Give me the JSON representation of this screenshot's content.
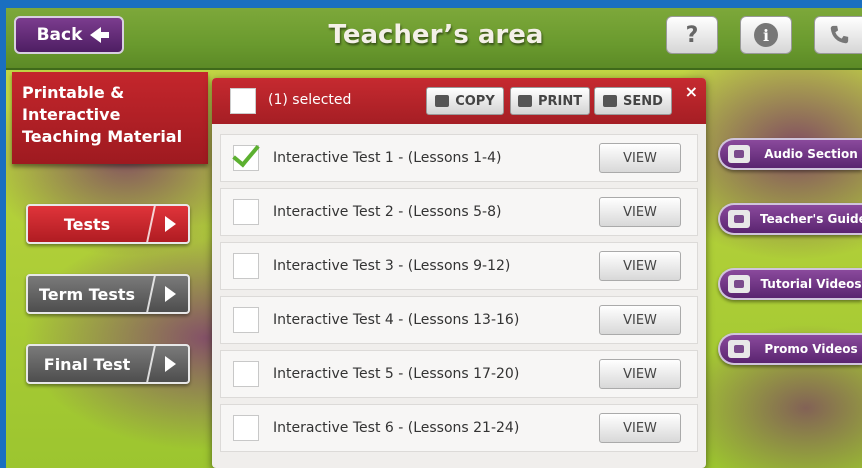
{
  "header": {
    "back_label": "Back",
    "title": "Teacher’s area",
    "help_glyph": "?",
    "info_glyph": "i",
    "icons": [
      "help-icon",
      "info-icon",
      "phone-icon"
    ]
  },
  "left": {
    "header_lines": [
      "Printable &",
      "Interactive",
      "Teaching Material"
    ],
    "buttons": [
      {
        "label": "Tests",
        "active": true
      },
      {
        "label": "Term Tests",
        "active": false
      },
      {
        "label": "Final Test",
        "active": false
      }
    ]
  },
  "panel": {
    "selected_text": "(1)  selected",
    "copy_label": "COPY",
    "print_label": "PRINT",
    "send_label": "SEND",
    "close_glyph": "×",
    "rows": [
      {
        "label": "Interactive Test 1 - (Lessons 1-4)",
        "checked": true,
        "view": "VIEW"
      },
      {
        "label": "Interactive Test 2 - (Lessons 5-8)",
        "checked": false,
        "view": "VIEW"
      },
      {
        "label": "Interactive Test 3 - (Lessons 9-12)",
        "checked": false,
        "view": "VIEW"
      },
      {
        "label": "Interactive Test 4 - (Lessons 13-16)",
        "checked": false,
        "view": "VIEW"
      },
      {
        "label": "Interactive Test 5 - (Lessons 17-20)",
        "checked": false,
        "view": "VIEW"
      },
      {
        "label": "Interactive Test 6 - (Lessons 21-24)",
        "checked": false,
        "view": "VIEW"
      }
    ]
  },
  "right": {
    "buttons": [
      {
        "label": "Audio Section",
        "icon": "headphones-icon"
      },
      {
        "label": "Teacher's Guide",
        "icon": "book-icon"
      },
      {
        "label": "Tutorial Videos",
        "icon": "video-icon"
      },
      {
        "label": "Promo Videos",
        "icon": "play-icon"
      }
    ]
  },
  "colors": {
    "accent_red": "#c62a30",
    "purple": "#5a2470",
    "green_bg": "#b4d13a",
    "check_green": "#5cb030"
  }
}
